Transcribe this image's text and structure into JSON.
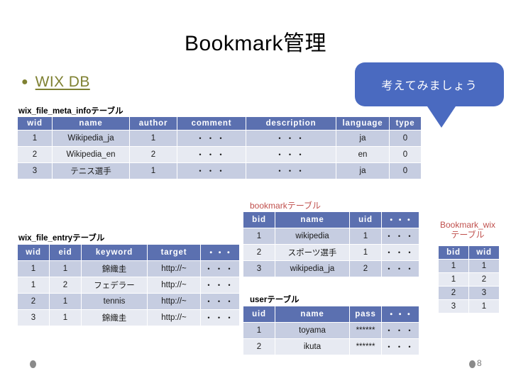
{
  "slide": {
    "title": "Bookmark管理",
    "page_number": "8"
  },
  "bullet": {
    "marker": "bullet-dot",
    "link_text": "WIX DB"
  },
  "callout": {
    "text": "考えてみましょう",
    "fill_color": "#4a6ac0",
    "text_color": "#ffffff"
  },
  "theme": {
    "header_blue": "#5b70b0",
    "row_odd": "#c6cde1",
    "row_even": "#e7eaf2",
    "caption_red": "#c0504d",
    "link_olive": "#7f8132"
  },
  "tables": {
    "wix_file_meta_info": {
      "caption": "wix_file_meta_infoテーブル",
      "columns": [
        "wid",
        "name",
        "author",
        "comment",
        "description",
        "language",
        "type"
      ],
      "rows": [
        [
          "1",
          "Wikipedia_ja",
          "1",
          "・・・",
          "・・・",
          "ja",
          "0"
        ],
        [
          "2",
          "Wikipedia_en",
          "2",
          "・・・",
          "・・・",
          "en",
          "0"
        ],
        [
          "3",
          "テニス選手",
          "1",
          "・・・",
          "・・・",
          "ja",
          "0"
        ]
      ]
    },
    "wix_file_entry": {
      "caption": "wix_file_entryテーブル",
      "columns": [
        "wid",
        "eid",
        "keyword",
        "target",
        "・・・"
      ],
      "rows": [
        [
          "1",
          "1",
          "錦織圭",
          "http://~",
          "・・・"
        ],
        [
          "1",
          "2",
          "フェデラー",
          "http://~",
          "・・・"
        ],
        [
          "2",
          "1",
          "tennis",
          "http://~",
          "・・・"
        ],
        [
          "3",
          "1",
          "錦織圭",
          "http://~",
          "・・・"
        ]
      ]
    },
    "bookmark": {
      "caption": "bookmarkテーブル",
      "columns": [
        "bid",
        "name",
        "uid",
        "・・・"
      ],
      "rows": [
        [
          "1",
          "wikipedia",
          "1",
          "・・・"
        ],
        [
          "2",
          "スポーツ選手",
          "1",
          "・・・"
        ],
        [
          "3",
          "wikipedia_ja",
          "2",
          "・・・"
        ]
      ]
    },
    "user": {
      "caption": "userテーブル",
      "columns": [
        "uid",
        "name",
        "pass",
        "・・・"
      ],
      "rows": [
        [
          "1",
          "toyama",
          "******",
          "・・・"
        ],
        [
          "2",
          "ikuta",
          "******",
          "・・・"
        ]
      ]
    },
    "bookmark_wix": {
      "caption_line1": "Bookmark_wix",
      "caption_line2": "テーブル",
      "columns": [
        "bid",
        "wid"
      ],
      "rows": [
        [
          "1",
          "1"
        ],
        [
          "1",
          "2"
        ],
        [
          "2",
          "3"
        ],
        [
          "3",
          "1"
        ]
      ]
    }
  }
}
